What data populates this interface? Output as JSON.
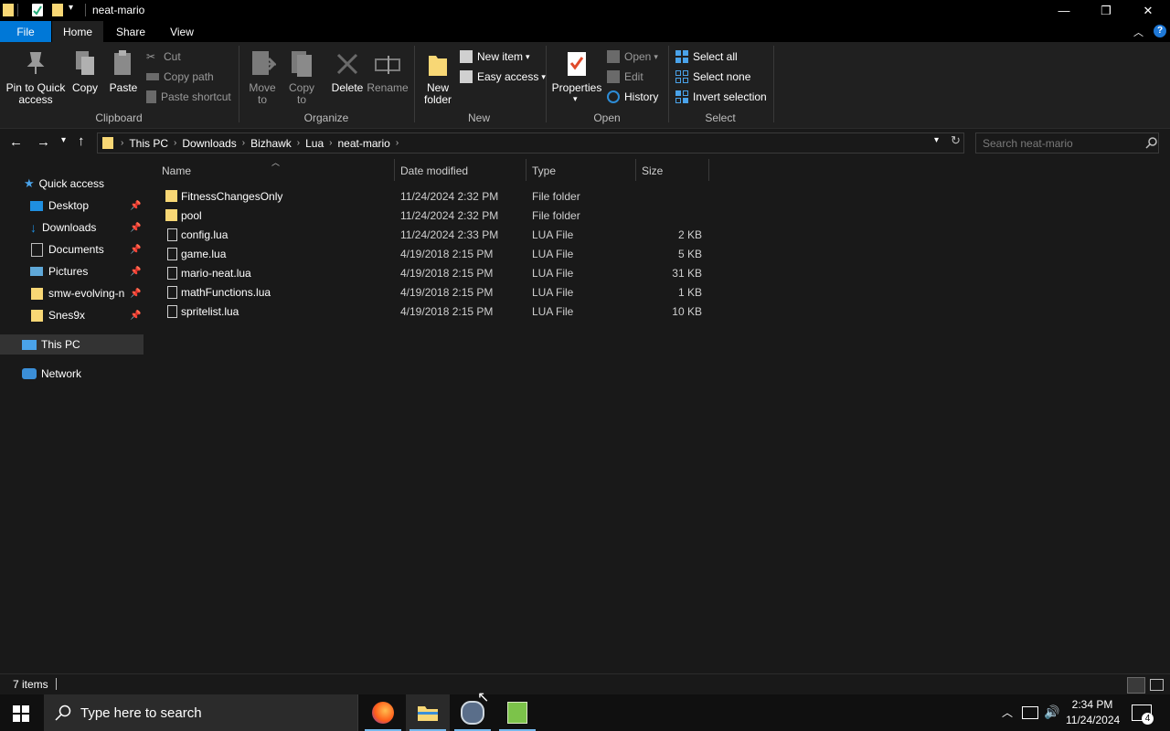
{
  "window": {
    "title": "neat-mario",
    "minimize_glyph": "—",
    "restore_glyph": "❐",
    "close_glyph": "✕"
  },
  "ribbon_tabs": {
    "file": "File",
    "home": "Home",
    "share": "Share",
    "view": "View"
  },
  "clipboard": {
    "pin_line1": "Pin to Quick",
    "pin_line2": "access",
    "copy": "Copy",
    "paste": "Paste",
    "cut": "Cut",
    "copy_path": "Copy path",
    "paste_shortcut": "Paste shortcut",
    "label": "Clipboard"
  },
  "organize": {
    "move_line1": "Move",
    "move_line2": "to",
    "copy_line1": "Copy",
    "copy_line2": "to",
    "delete": "Delete",
    "rename": "Rename",
    "label": "Organize"
  },
  "new_group": {
    "new_folder_line1": "New",
    "new_folder_line2": "folder",
    "new_item": "New item",
    "easy_access": "Easy access",
    "label": "New"
  },
  "open_group": {
    "properties": "Properties",
    "open": "Open",
    "edit": "Edit",
    "history": "History",
    "label": "Open"
  },
  "select_group": {
    "select_all": "Select all",
    "select_none": "Select none",
    "invert_selection": "Invert selection",
    "label": "Select"
  },
  "address": {
    "crumbs": [
      "This PC",
      "Downloads",
      "Bizhawk",
      "Lua",
      "neat-mario"
    ],
    "search_placeholder": "Search neat-mario"
  },
  "nav_pane": {
    "quick_access": "Quick access",
    "desktop": "Desktop",
    "downloads": "Downloads",
    "documents": "Documents",
    "pictures": "Pictures",
    "smw": "smw-evolving-n",
    "snes9x": "Snes9x",
    "this_pc": "This PC",
    "network": "Network"
  },
  "columns": {
    "name": "Name",
    "date_modified": "Date modified",
    "type": "Type",
    "size": "Size"
  },
  "files": [
    {
      "name": "FitnessChangesOnly",
      "date": "11/24/2024 2:32 PM",
      "type": "File folder",
      "size": "",
      "icon": "folder-icon"
    },
    {
      "name": "pool",
      "date": "11/24/2024 2:32 PM",
      "type": "File folder",
      "size": "",
      "icon": "folder-icon"
    },
    {
      "name": "config.lua",
      "date": "11/24/2024 2:33 PM",
      "type": "LUA File",
      "size": "2 KB",
      "icon": "file-icon"
    },
    {
      "name": "game.lua",
      "date": "4/19/2018 2:15 PM",
      "type": "LUA File",
      "size": "5 KB",
      "icon": "file-icon"
    },
    {
      "name": "mario-neat.lua",
      "date": "4/19/2018 2:15 PM",
      "type": "LUA File",
      "size": "31 KB",
      "icon": "file-icon"
    },
    {
      "name": "mathFunctions.lua",
      "date": "4/19/2018 2:15 PM",
      "type": "LUA File",
      "size": "1 KB",
      "icon": "file-icon"
    },
    {
      "name": "spritelist.lua",
      "date": "4/19/2018 2:15 PM",
      "type": "LUA File",
      "size": "10 KB",
      "icon": "file-icon"
    }
  ],
  "status": {
    "item_count": "7 items"
  },
  "taskbar": {
    "search_placeholder": "Type here to search",
    "time": "2:34 PM",
    "date": "11/24/2024",
    "notification_count": "4"
  },
  "colors": {
    "accent": "#0078d7",
    "folder": "#f8d775",
    "background": "#191919"
  }
}
